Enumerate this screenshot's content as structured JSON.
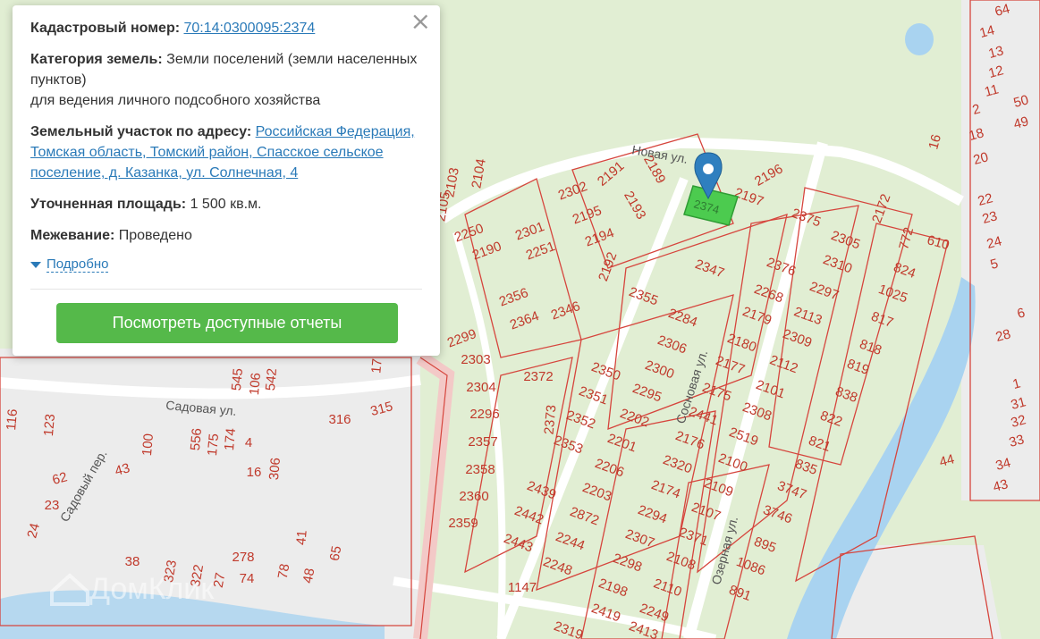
{
  "popup": {
    "cadastral_label": "Кадастровый номер:",
    "cadastral_value": "70:14:0300095:2374",
    "category_label": "Категория земель:",
    "category_value": "Земли поселений (земли населенных пунктов)",
    "category_use": "для ведения личного подсобного хозяйства",
    "address_label": "Земельный участок по адресу:",
    "address_value": "Российская Федерация, Томская область, Томский район, Спасское сельское поселение, д. Казанка, ул. Солнечная, 4",
    "area_label": "Уточненная площадь:",
    "area_value": "1 500 кв.м.",
    "survey_label": "Межевание:",
    "survey_value": "Проведено",
    "details_link": "Подробно",
    "reports_button": "Посмотреть доступные отчеты",
    "close_symbol": "×"
  },
  "map": {
    "selected_parcel": "2374",
    "watermark": "ДомКлик",
    "streets": {
      "novaya": "Новая ул.",
      "sadovaya": "Садовая ул.",
      "sadovy_per": "Садовый пер.",
      "sosnovaya": "Сосновая ул.",
      "ozernaya": "Озерная ул."
    },
    "parcel_labels": [
      "64",
      "14",
      "13",
      "12",
      "11",
      "2",
      "50",
      "49",
      "16",
      "18",
      "20",
      "22",
      "23",
      "24",
      "5",
      "6",
      "28",
      "1",
      "31",
      "32",
      "33",
      "34",
      "43",
      "44",
      "610",
      "772",
      "824",
      "1025",
      "817",
      "818",
      "819",
      "838",
      "822",
      "821",
      "835",
      "3747",
      "3746",
      "895",
      "1086",
      "891",
      "2172",
      "2375",
      "2305",
      "2310",
      "2297",
      "2376",
      "2268",
      "2113",
      "2179",
      "2309",
      "2180",
      "2112",
      "2177",
      "2101",
      "2175",
      "2308",
      "2441",
      "2519",
      "2176",
      "2100",
      "2320",
      "2109",
      "2174",
      "2107",
      "2294",
      "2371",
      "2307",
      "2108",
      "2298",
      "2110",
      "2198",
      "2249",
      "2419",
      "2413",
      "2319",
      "2355",
      "2284",
      "2306",
      "2300",
      "2350",
      "2295",
      "2351",
      "2202",
      "2352",
      "2201",
      "2353",
      "2206",
      "2203",
      "2439",
      "2872",
      "2442",
      "2244",
      "2443",
      "2248",
      "1147",
      "2347",
      "2197",
      "2196",
      "2191",
      "2189",
      "2302",
      "2195",
      "2193",
      "2194",
      "2192",
      "2301",
      "2251",
      "2190",
      "2250",
      "2103",
      "2104",
      "2105",
      "2356",
      "2364",
      "2346",
      "2299",
      "2303",
      "2304",
      "2296",
      "2357",
      "2358",
      "2360",
      "2359",
      "2372",
      "2373",
      "316",
      "315",
      "306",
      "4",
      "16",
      "175",
      "174",
      "556",
      "100",
      "545",
      "106",
      "542",
      "123",
      "116",
      "62",
      "43",
      "23",
      "24",
      "38",
      "323",
      "322",
      "27",
      "278",
      "74",
      "78",
      "41",
      "48",
      "65",
      "17"
    ]
  }
}
